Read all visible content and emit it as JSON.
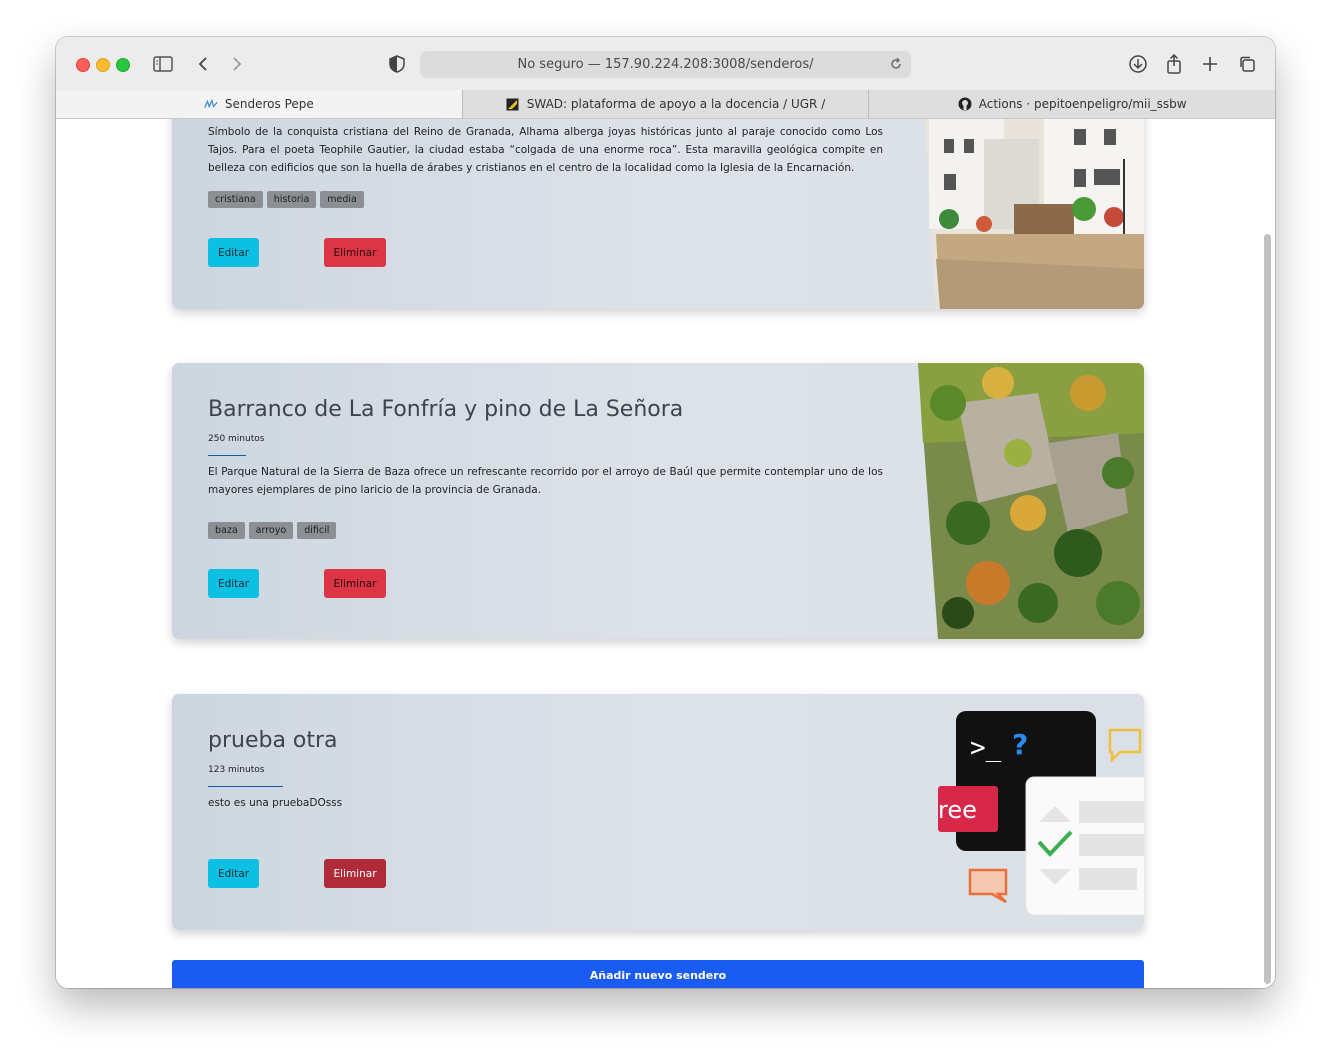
{
  "browser": {
    "url": "No seguro — 157.90.224.208:3008/senderos/",
    "tabs": [
      {
        "label": "Senderos Pepe",
        "icon": "senderos-logo-icon"
      },
      {
        "label": "SWAD: plataforma de apoyo a la docencia / UGR /",
        "icon": "swad-logo-icon"
      },
      {
        "label": "Actions · pepitoenpeligro/mii_ssbw",
        "icon": "github-icon"
      }
    ]
  },
  "cards": [
    {
      "title": "",
      "duration": "",
      "description": "Símbolo de la conquista cristiana del Reino de Granada, Alhama alberga joyas históricas junto al paraje conocido como Los Tajos. Para el poeta Teophile Gautier, la ciudad estaba “colgada de una enorme roca”. Esta maravilla geológica compite en belleza con edificios que son la huella de árabes y cristianos en el centro de la localidad como la Iglesia de la Encarnación.",
      "tags": [
        "cristiana",
        "historia",
        "media"
      ],
      "edit_label": "Editar",
      "delete_label": "Eliminar",
      "image": "village-street-photo"
    },
    {
      "title": "Barranco de La Fonfría y pino de La Señora",
      "duration": "250 minutos",
      "description": "El Parque Natural de la Sierra de Baza ofrece un refrescante recorrido por el arroyo de Baúl que permite contemplar uno de los mayores ejemplares de pino laricio de la provincia de Granada.",
      "tags": [
        "baza",
        "arroyo",
        "dificil"
      ],
      "edit_label": "Editar",
      "delete_label": "Eliminar",
      "image": "forest-ravine-photo"
    },
    {
      "title": "prueba otra",
      "duration": "123 minutos",
      "description": "esto es una pruebaDOsss",
      "tags": [],
      "edit_label": "Editar",
      "delete_label": "Eliminar",
      "image": "terminal-illustration",
      "illustration": {
        "prompt": ">_",
        "question": "?",
        "badge": "ree"
      }
    }
  ],
  "add_button_label": "Añadir nuevo sendero",
  "colors": {
    "edit": "#0cc0e4",
    "delete": "#dc3545",
    "add": "#1a5cf2",
    "duration_rule": "#1a5aa0"
  }
}
